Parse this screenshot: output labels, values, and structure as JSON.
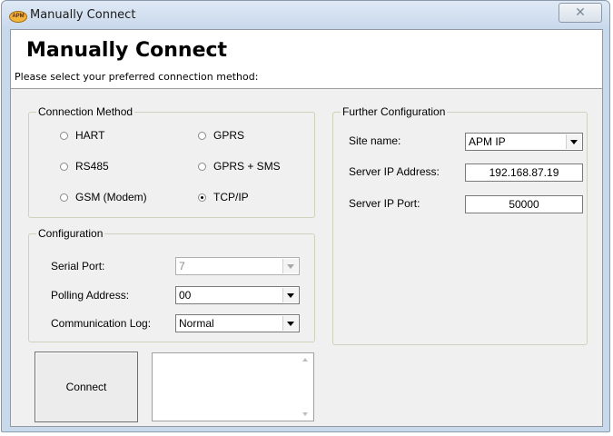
{
  "window": {
    "title": "Manually Connect",
    "close_label": "✕",
    "app_icon_text": "APM"
  },
  "header": {
    "title": "Manually Connect",
    "subtitle": "Please select your preferred connection method:"
  },
  "connection_method": {
    "legend": "Connection Method",
    "options": [
      {
        "label": "HART",
        "selected": false
      },
      {
        "label": "GPRS",
        "selected": false
      },
      {
        "label": "RS485",
        "selected": false
      },
      {
        "label": "GPRS + SMS",
        "selected": false
      },
      {
        "label": "GSM (Modem)",
        "selected": false
      },
      {
        "label": "TCP/IP",
        "selected": true
      }
    ]
  },
  "configuration": {
    "legend": "Configuration",
    "serial_port": {
      "label": "Serial Port:",
      "value": "7"
    },
    "polling_address": {
      "label": "Polling Address:",
      "value": "00"
    },
    "communication_log": {
      "label": "Communication Log:",
      "value": "Normal"
    }
  },
  "further_configuration": {
    "legend": "Further Configuration",
    "site_name": {
      "label": "Site name:",
      "value": "APM IP"
    },
    "server_ip": {
      "label": "Server IP Address:",
      "value": "192.168.87.19"
    },
    "server_port": {
      "label": "Server IP Port:",
      "value": "50000"
    }
  },
  "actions": {
    "connect_label": "Connect"
  }
}
